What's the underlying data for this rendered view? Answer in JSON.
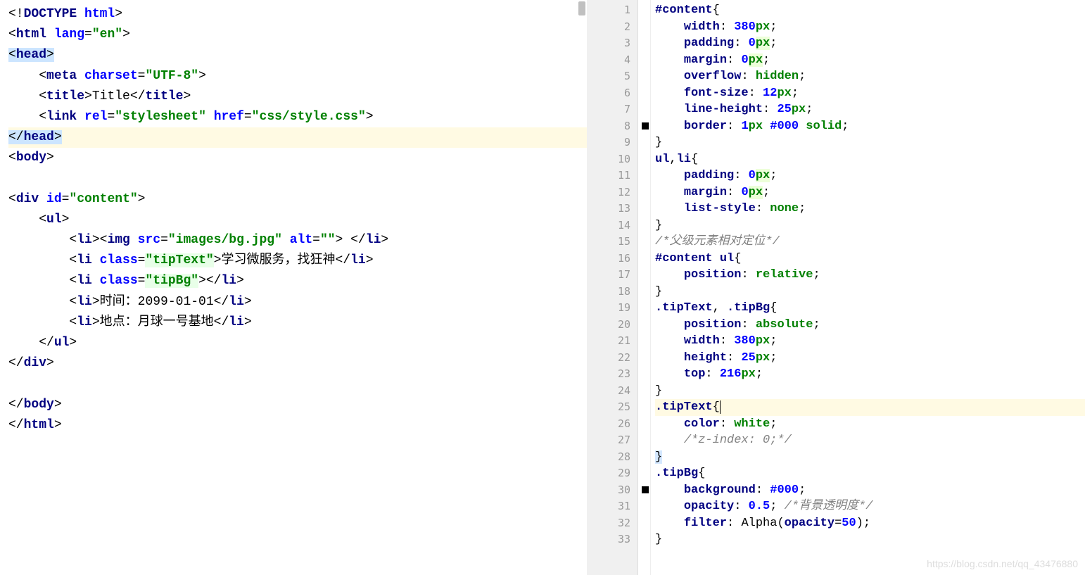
{
  "left": {
    "lines": [
      {
        "t": "html",
        "tokens": [
          [
            "<!",
            "punc"
          ],
          [
            "DOCTYPE ",
            "tag"
          ],
          [
            "html",
            "attr"
          ],
          [
            ">",
            "punc"
          ]
        ]
      },
      {
        "t": "html",
        "tokens": [
          [
            "<",
            "punc"
          ],
          [
            "html ",
            "tag"
          ],
          [
            "lang",
            "attr"
          ],
          [
            "=",
            "punc"
          ],
          [
            "\"en\"",
            "str"
          ],
          [
            ">",
            "punc"
          ]
        ]
      },
      {
        "t": "html",
        "sel": true,
        "tokens": [
          [
            "<",
            "punc"
          ],
          [
            "head",
            "tag"
          ],
          [
            ">",
            "punc"
          ]
        ]
      },
      {
        "t": "html",
        "tokens": [
          [
            "    <",
            "punc"
          ],
          [
            "meta ",
            "tag"
          ],
          [
            "charset",
            "attr"
          ],
          [
            "=",
            "punc"
          ],
          [
            "\"UTF-8\"",
            "str"
          ],
          [
            ">",
            "punc"
          ]
        ]
      },
      {
        "t": "html",
        "tokens": [
          [
            "    <",
            "punc"
          ],
          [
            "title",
            "tag"
          ],
          [
            ">",
            "punc"
          ],
          [
            "Title",
            "txt"
          ],
          [
            "</",
            "punc"
          ],
          [
            "title",
            "tag"
          ],
          [
            ">",
            "punc"
          ]
        ]
      },
      {
        "t": "html",
        "tokens": [
          [
            "    <",
            "punc"
          ],
          [
            "link ",
            "tag"
          ],
          [
            "rel",
            "attr"
          ],
          [
            "=",
            "punc"
          ],
          [
            "\"stylesheet\"",
            "str"
          ],
          [
            " ",
            "txt"
          ],
          [
            "href",
            "attr"
          ],
          [
            "=",
            "punc"
          ],
          [
            "\"css/style.css\"",
            "str"
          ],
          [
            ">",
            "punc"
          ]
        ]
      },
      {
        "t": "html",
        "sel": true,
        "hl": true,
        "tokens": [
          [
            "</",
            "punc"
          ],
          [
            "head",
            "tag"
          ],
          [
            ">",
            "punc"
          ]
        ]
      },
      {
        "t": "html",
        "tokens": [
          [
            "<",
            "punc"
          ],
          [
            "body",
            "tag"
          ],
          [
            ">",
            "punc"
          ]
        ]
      },
      {
        "t": "blank"
      },
      {
        "t": "html",
        "tokens": [
          [
            "<",
            "punc"
          ],
          [
            "div ",
            "tag"
          ],
          [
            "id",
            "attr"
          ],
          [
            "=",
            "punc"
          ],
          [
            "\"content\"",
            "str"
          ],
          [
            ">",
            "punc"
          ]
        ]
      },
      {
        "t": "html",
        "tokens": [
          [
            "    <",
            "punc"
          ],
          [
            "ul",
            "tag"
          ],
          [
            ">",
            "punc"
          ]
        ]
      },
      {
        "t": "html",
        "tokens": [
          [
            "        <",
            "punc"
          ],
          [
            "li",
            "tag"
          ],
          [
            "><",
            "punc"
          ],
          [
            "img ",
            "tag"
          ],
          [
            "src",
            "attr"
          ],
          [
            "=",
            "punc"
          ],
          [
            "\"images/bg.jpg\"",
            "str"
          ],
          [
            " ",
            "txt"
          ],
          [
            "alt",
            "attr"
          ],
          [
            "=",
            "punc"
          ],
          [
            "\"\"",
            "str"
          ],
          [
            "> </",
            "punc"
          ],
          [
            "li",
            "tag"
          ],
          [
            ">",
            "punc"
          ]
        ]
      },
      {
        "t": "html",
        "tokens": [
          [
            "        <",
            "punc"
          ],
          [
            "li ",
            "tag"
          ],
          [
            "class",
            "attr"
          ],
          [
            "=",
            "punc"
          ],
          [
            "\"tipText\"",
            "str-attr"
          ],
          [
            ">",
            "punc"
          ],
          [
            "学习微服务，找狂神",
            "txt"
          ],
          [
            "</",
            "punc"
          ],
          [
            "li",
            "tag"
          ],
          [
            ">",
            "punc"
          ]
        ]
      },
      {
        "t": "html",
        "tokens": [
          [
            "        <",
            "punc"
          ],
          [
            "li ",
            "tag"
          ],
          [
            "class",
            "attr"
          ],
          [
            "=",
            "punc"
          ],
          [
            "\"tipBg\"",
            "str-attr"
          ],
          [
            "></",
            "punc"
          ],
          [
            "li",
            "tag"
          ],
          [
            ">",
            "punc"
          ]
        ]
      },
      {
        "t": "html",
        "tokens": [
          [
            "        <",
            "punc"
          ],
          [
            "li",
            "tag"
          ],
          [
            ">",
            "punc"
          ],
          [
            "时间：2099-01-01",
            "txt"
          ],
          [
            "</",
            "punc"
          ],
          [
            "li",
            "tag"
          ],
          [
            ">",
            "punc"
          ]
        ]
      },
      {
        "t": "html",
        "tokens": [
          [
            "        <",
            "punc"
          ],
          [
            "li",
            "tag"
          ],
          [
            ">",
            "punc"
          ],
          [
            "地点：月球一号基地",
            "txt"
          ],
          [
            "</",
            "punc"
          ],
          [
            "li",
            "tag"
          ],
          [
            ">",
            "punc"
          ]
        ]
      },
      {
        "t": "html",
        "tokens": [
          [
            "    </",
            "punc"
          ],
          [
            "ul",
            "tag"
          ],
          [
            ">",
            "punc"
          ]
        ]
      },
      {
        "t": "html",
        "tokens": [
          [
            "</",
            "punc"
          ],
          [
            "div",
            "tag"
          ],
          [
            ">",
            "punc"
          ]
        ]
      },
      {
        "t": "blank"
      },
      {
        "t": "html",
        "tokens": [
          [
            "</",
            "punc"
          ],
          [
            "body",
            "tag"
          ],
          [
            ">",
            "punc"
          ]
        ]
      },
      {
        "t": "html",
        "tokens": [
          [
            "</",
            "punc"
          ],
          [
            "html",
            "tag"
          ],
          [
            ">",
            "punc"
          ]
        ]
      }
    ]
  },
  "right": {
    "lines": [
      {
        "n": 1,
        "tokens": [
          [
            "#content",
            "sel"
          ],
          [
            "{",
            "punc"
          ]
        ]
      },
      {
        "n": 2,
        "tokens": [
          [
            "    ",
            "txt"
          ],
          [
            "width",
            "prop"
          ],
          [
            ": ",
            "punc"
          ],
          [
            "380",
            "num"
          ],
          [
            "px",
            "unit"
          ],
          [
            ";",
            "punc"
          ]
        ]
      },
      {
        "n": 3,
        "tokens": [
          [
            "    ",
            "txt"
          ],
          [
            "padding",
            "prop"
          ],
          [
            ": ",
            "punc"
          ],
          [
            "0",
            "num"
          ],
          [
            "px",
            "unit hl-unit"
          ],
          [
            ";",
            "punc"
          ]
        ]
      },
      {
        "n": 4,
        "tokens": [
          [
            "    ",
            "txt"
          ],
          [
            "margin",
            "prop"
          ],
          [
            ": ",
            "punc"
          ],
          [
            "0",
            "num"
          ],
          [
            "px",
            "unit hl-unit"
          ],
          [
            ";",
            "punc"
          ]
        ]
      },
      {
        "n": 5,
        "tokens": [
          [
            "    ",
            "txt"
          ],
          [
            "overflow",
            "prop"
          ],
          [
            ": ",
            "punc"
          ],
          [
            "hidden",
            "val"
          ],
          [
            ";",
            "punc"
          ]
        ]
      },
      {
        "n": 6,
        "tokens": [
          [
            "    ",
            "txt"
          ],
          [
            "font-size",
            "prop"
          ],
          [
            ": ",
            "punc"
          ],
          [
            "12",
            "num"
          ],
          [
            "px",
            "unit"
          ],
          [
            ";",
            "punc"
          ]
        ]
      },
      {
        "n": 7,
        "tokens": [
          [
            "    ",
            "txt"
          ],
          [
            "line-height",
            "prop"
          ],
          [
            ": ",
            "punc"
          ],
          [
            "25",
            "num"
          ],
          [
            "px",
            "unit"
          ],
          [
            ";",
            "punc"
          ]
        ]
      },
      {
        "n": 8,
        "bp": true,
        "tokens": [
          [
            "    ",
            "txt"
          ],
          [
            "border",
            "prop"
          ],
          [
            ": ",
            "punc"
          ],
          [
            "1",
            "num"
          ],
          [
            "px",
            "unit"
          ],
          [
            " ",
            "txt"
          ],
          [
            "#000",
            "num"
          ],
          [
            " ",
            "txt"
          ],
          [
            "solid",
            "val"
          ],
          [
            ";",
            "punc"
          ]
        ]
      },
      {
        "n": 9,
        "tokens": [
          [
            "}",
            "punc"
          ]
        ]
      },
      {
        "n": 10,
        "tokens": [
          [
            "ul",
            "sel"
          ],
          [
            ",",
            "punc"
          ],
          [
            "li",
            "sel"
          ],
          [
            "{",
            "punc"
          ]
        ]
      },
      {
        "n": 11,
        "tokens": [
          [
            "    ",
            "txt"
          ],
          [
            "padding",
            "prop"
          ],
          [
            ": ",
            "punc"
          ],
          [
            "0",
            "num"
          ],
          [
            "px",
            "unit hl-unit"
          ],
          [
            ";",
            "punc"
          ]
        ]
      },
      {
        "n": 12,
        "tokens": [
          [
            "    ",
            "txt"
          ],
          [
            "margin",
            "prop"
          ],
          [
            ": ",
            "punc"
          ],
          [
            "0",
            "num"
          ],
          [
            "px",
            "unit hl-unit"
          ],
          [
            ";",
            "punc"
          ]
        ]
      },
      {
        "n": 13,
        "tokens": [
          [
            "    ",
            "txt"
          ],
          [
            "list-style",
            "prop"
          ],
          [
            ": ",
            "punc"
          ],
          [
            "none",
            "val"
          ],
          [
            ";",
            "punc"
          ]
        ]
      },
      {
        "n": 14,
        "tokens": [
          [
            "}",
            "punc"
          ]
        ]
      },
      {
        "n": 15,
        "tokens": [
          [
            "/*父级元素相对定位*/",
            "cm"
          ]
        ]
      },
      {
        "n": 16,
        "tokens": [
          [
            "#content ul",
            "sel"
          ],
          [
            "{",
            "punc"
          ]
        ]
      },
      {
        "n": 17,
        "tokens": [
          [
            "    ",
            "txt"
          ],
          [
            "position",
            "prop"
          ],
          [
            ": ",
            "punc"
          ],
          [
            "relative",
            "val"
          ],
          [
            ";",
            "punc"
          ]
        ]
      },
      {
        "n": 18,
        "tokens": [
          [
            "}",
            "punc"
          ]
        ]
      },
      {
        "n": 19,
        "tokens": [
          [
            ".tipText",
            "sel"
          ],
          [
            ", ",
            "punc"
          ],
          [
            ".tipBg",
            "sel"
          ],
          [
            "{",
            "punc"
          ]
        ]
      },
      {
        "n": 20,
        "tokens": [
          [
            "    ",
            "txt"
          ],
          [
            "position",
            "prop"
          ],
          [
            ": ",
            "punc"
          ],
          [
            "absolute",
            "val"
          ],
          [
            ";",
            "punc"
          ]
        ]
      },
      {
        "n": 21,
        "tokens": [
          [
            "    ",
            "txt"
          ],
          [
            "width",
            "prop"
          ],
          [
            ": ",
            "punc"
          ],
          [
            "380",
            "num"
          ],
          [
            "px",
            "unit"
          ],
          [
            ";",
            "punc"
          ]
        ]
      },
      {
        "n": 22,
        "tokens": [
          [
            "    ",
            "txt"
          ],
          [
            "height",
            "prop"
          ],
          [
            ": ",
            "punc"
          ],
          [
            "25",
            "num"
          ],
          [
            "px",
            "unit"
          ],
          [
            ";",
            "punc"
          ]
        ]
      },
      {
        "n": 23,
        "tokens": [
          [
            "    ",
            "txt"
          ],
          [
            "top",
            "prop"
          ],
          [
            ": ",
            "punc"
          ],
          [
            "216",
            "num"
          ],
          [
            "px",
            "unit"
          ],
          [
            ";",
            "punc"
          ]
        ]
      },
      {
        "n": 24,
        "tokens": [
          [
            "}",
            "punc"
          ]
        ]
      },
      {
        "n": 25,
        "hl": true,
        "tokens": [
          [
            ".tipText",
            "sel"
          ],
          [
            "{",
            "punc cursor-caret"
          ]
        ]
      },
      {
        "n": 26,
        "tokens": [
          [
            "    ",
            "txt"
          ],
          [
            "color",
            "prop"
          ],
          [
            ": ",
            "punc"
          ],
          [
            "white",
            "val"
          ],
          [
            ";",
            "punc"
          ]
        ]
      },
      {
        "n": 27,
        "tokens": [
          [
            "    ",
            "txt"
          ],
          [
            "/*z-index: 0;*/",
            "cm"
          ]
        ]
      },
      {
        "n": 28,
        "tokens": [
          [
            "}",
            "punc brace-hl"
          ]
        ]
      },
      {
        "n": 29,
        "tokens": [
          [
            ".tipBg",
            "sel"
          ],
          [
            "{",
            "punc"
          ]
        ]
      },
      {
        "n": 30,
        "bp": true,
        "tokens": [
          [
            "    ",
            "txt"
          ],
          [
            "background",
            "prop"
          ],
          [
            ": ",
            "punc"
          ],
          [
            "#000",
            "num"
          ],
          [
            ";",
            "punc"
          ]
        ]
      },
      {
        "n": 31,
        "tokens": [
          [
            "    ",
            "txt"
          ],
          [
            "opacity",
            "prop"
          ],
          [
            ": ",
            "punc"
          ],
          [
            "0.5",
            "num"
          ],
          [
            "; ",
            "punc"
          ],
          [
            "/*背景透明度*/",
            "cm"
          ]
        ]
      },
      {
        "n": 32,
        "tokens": [
          [
            "    ",
            "txt"
          ],
          [
            "filter",
            "prop"
          ],
          [
            ": ",
            "punc"
          ],
          [
            "Alpha",
            "txt"
          ],
          [
            "(",
            "punc"
          ],
          [
            "opacity",
            "prop"
          ],
          [
            "=",
            "punc"
          ],
          [
            "50",
            "num"
          ],
          [
            ")",
            "punc"
          ],
          [
            ";",
            "punc"
          ]
        ]
      },
      {
        "n": 33,
        "tokens": [
          [
            "}",
            "punc"
          ]
        ]
      }
    ]
  },
  "watermark": "https://blog.csdn.net/qq_43476880"
}
